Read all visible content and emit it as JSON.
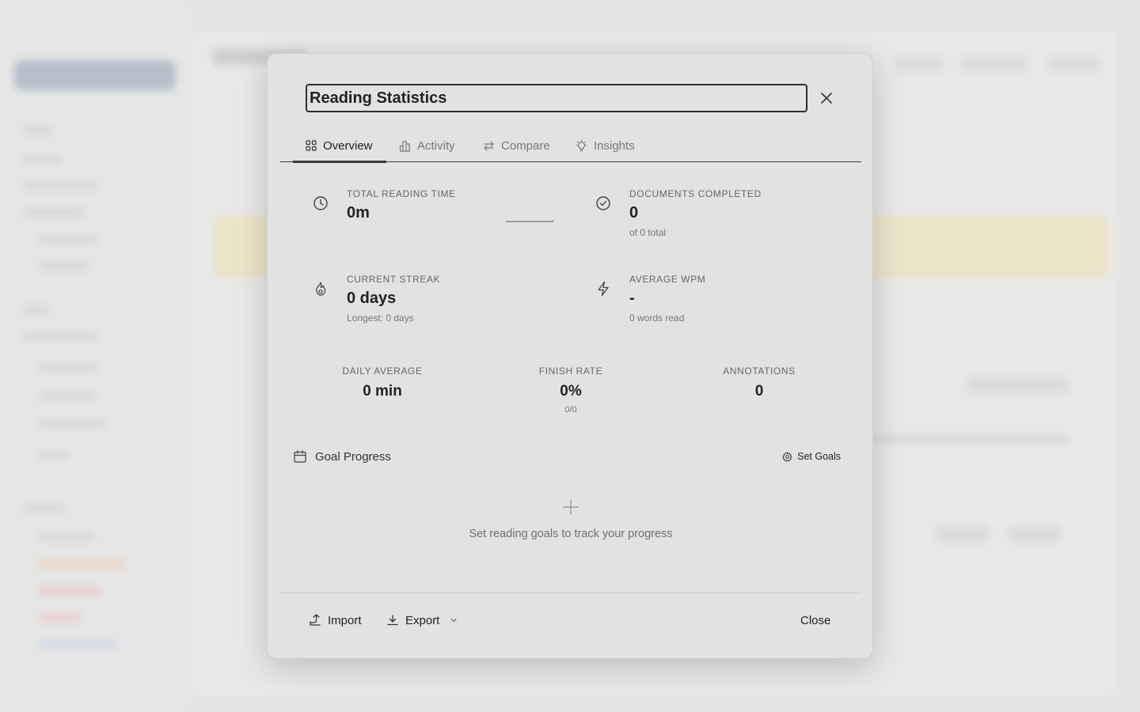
{
  "dialog": {
    "title_value": "Reading Statistics",
    "close_icon": "close-icon"
  },
  "tabs": [
    {
      "label": "Overview",
      "icon": "grid-icon",
      "active": true
    },
    {
      "label": "Activity",
      "icon": "bar-chart-icon",
      "active": false
    },
    {
      "label": "Compare",
      "icon": "arrows-exchange-icon",
      "active": false
    },
    {
      "label": "Insights",
      "icon": "lightbulb-icon",
      "active": false
    }
  ],
  "stats": {
    "total_reading_time": {
      "label": "TOTAL READING TIME",
      "value": "0m",
      "icon": "clock-icon"
    },
    "documents_completed": {
      "label": "DOCUMENTS COMPLETED",
      "value": "0",
      "sub": "of 0 total",
      "icon": "check-circle-icon"
    },
    "current_streak": {
      "label": "CURRENT STREAK",
      "value": "0 days",
      "sub": "Longest: 0 days",
      "icon": "flame-icon"
    },
    "average_wpm": {
      "label": "AVERAGE WPM",
      "value": "-",
      "sub": "0 words read",
      "icon": "lightning-icon"
    }
  },
  "summary": {
    "daily_average": {
      "label": "DAILY AVERAGE",
      "value": "0 min"
    },
    "finish_rate": {
      "label": "FINISH RATE",
      "value": "0%",
      "sub": "0/0"
    },
    "annotations": {
      "label": "ANNOTATIONS",
      "value": "0"
    }
  },
  "goals": {
    "title": "Goal Progress",
    "set_goals_label": "Set Goals",
    "empty_text": "Set reading goals to track your progress"
  },
  "footer": {
    "import_label": "Import",
    "export_label": "Export",
    "close_label": "Close"
  },
  "colors": {
    "modal_bg": "#e2e2e2",
    "text_primary": "#222222",
    "text_muted": "#777777",
    "backdrop_banner": "#f1e4b4"
  }
}
